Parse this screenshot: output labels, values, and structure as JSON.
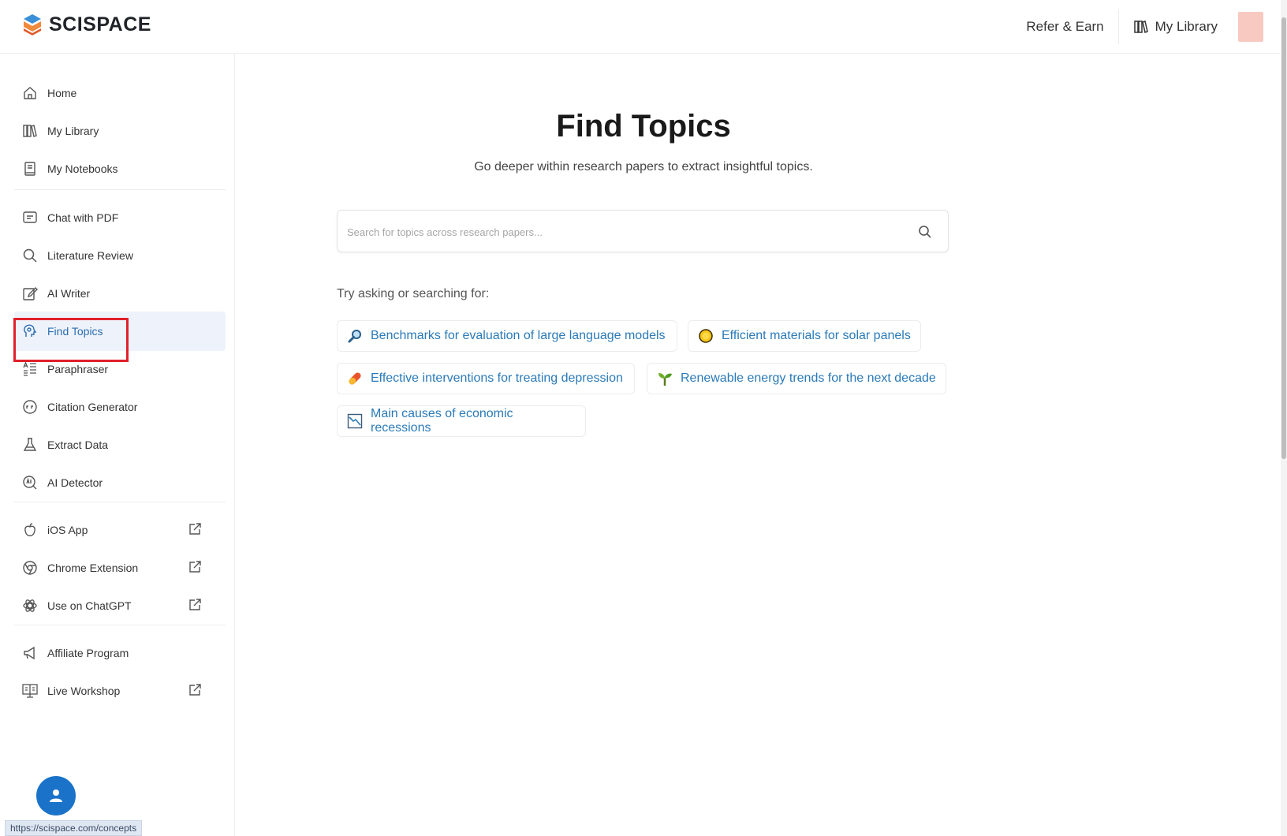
{
  "header": {
    "brand": "SCISPACE",
    "refer_label": "Refer & Earn",
    "library_label": "My Library"
  },
  "sidebar": {
    "items": [
      {
        "label": "Home",
        "icon": "home-icon"
      },
      {
        "label": "My Library",
        "icon": "library-icon"
      },
      {
        "label": "My Notebooks",
        "icon": "notebook-icon"
      },
      {
        "label": "Chat with PDF",
        "icon": "chat-icon"
      },
      {
        "label": "Literature Review",
        "icon": "search-icon"
      },
      {
        "label": "AI Writer",
        "icon": "edit-icon"
      },
      {
        "label": "Find Topics",
        "icon": "topics-icon",
        "active": true
      },
      {
        "label": "Paraphraser",
        "icon": "paraphrase-icon"
      },
      {
        "label": "Citation Generator",
        "icon": "citation-icon"
      },
      {
        "label": "Extract Data",
        "icon": "flask-icon"
      },
      {
        "label": "AI Detector",
        "icon": "detector-icon"
      },
      {
        "label": "iOS App",
        "icon": "apple-icon",
        "external": true
      },
      {
        "label": "Chrome Extension",
        "icon": "chrome-icon",
        "external": true
      },
      {
        "label": "Use on ChatGPT",
        "icon": "chatgpt-icon",
        "external": true
      },
      {
        "label": "Affiliate Program",
        "icon": "megaphone-icon"
      },
      {
        "label": "Live Workshop",
        "icon": "workshop-icon",
        "external": true
      }
    ]
  },
  "main": {
    "title": "Find Topics",
    "subtitle": "Go deeper within research papers to extract insightful topics.",
    "search_placeholder": "Search for topics across research papers...",
    "try_label": "Try asking or searching for:",
    "suggestions": [
      {
        "label": "Benchmarks for evaluation of large language models",
        "icon": "magnifier-icon"
      },
      {
        "label": "Efficient materials for solar panels",
        "icon": "sun-icon"
      },
      {
        "label": "Effective interventions for treating depression",
        "icon": "pill-icon"
      },
      {
        "label": "Renewable energy trends for the next decade",
        "icon": "sprout-icon"
      },
      {
        "label": "Main causes of economic recessions",
        "icon": "chart-down-icon"
      }
    ]
  },
  "status_url": "https://scispace.com/concepts",
  "colors": {
    "accent": "#2a7ab8",
    "highlight": "#e0202a",
    "chat_bubble": "#1a73c8"
  }
}
